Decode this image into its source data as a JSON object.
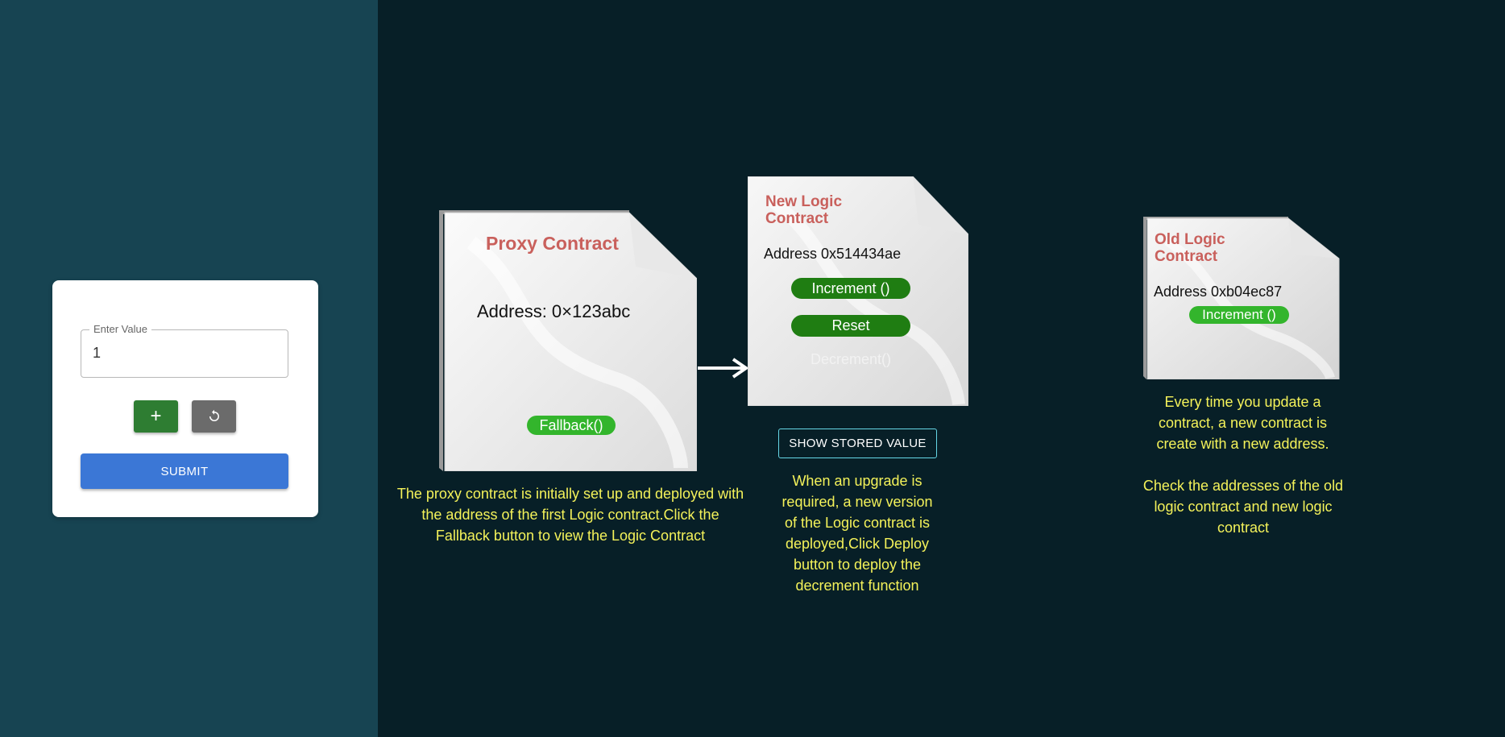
{
  "form": {
    "field_label": "Enter Value",
    "field_value": "1",
    "plus_symbol": "+",
    "submit_label": "SUBMIT"
  },
  "proxy": {
    "title": "Proxy Contract",
    "address": "Address: 0×123abc",
    "fallback_label": "Fallback()",
    "caption": "The proxy contract is initially set up and deployed with the address of the first Logic contract.Click the Fallback button to view the Logic Contract"
  },
  "new_logic": {
    "title": "New  Logic Contract",
    "address": "Address 0x514434ae",
    "increment_label": "Increment ()",
    "reset_label": "Reset",
    "decrement_label": "Decrement()",
    "show_button": "SHOW STORED VALUE",
    "caption": "When an upgrade is required, a new version of the Logic contract is deployed,Click Deploy button to deploy the decrement function"
  },
  "old_logic": {
    "title": "Old  Logic Contract",
    "address": "Address 0xb04ec87",
    "increment_label": "Increment ()",
    "caption_1": "Every time you update a contract, a new contract is create with a new address.",
    "caption_2": "Check the addresses of the old logic contract and new logic contract"
  },
  "colors": {
    "left_bg": "#174452",
    "right_bg": "#071f27",
    "caption_yellow": "#f4f25a",
    "title_red": "#c9605c",
    "pill_green": "#33b52c",
    "dark_pill_green": "#1f7d12",
    "submit_blue": "#3b77d6"
  }
}
